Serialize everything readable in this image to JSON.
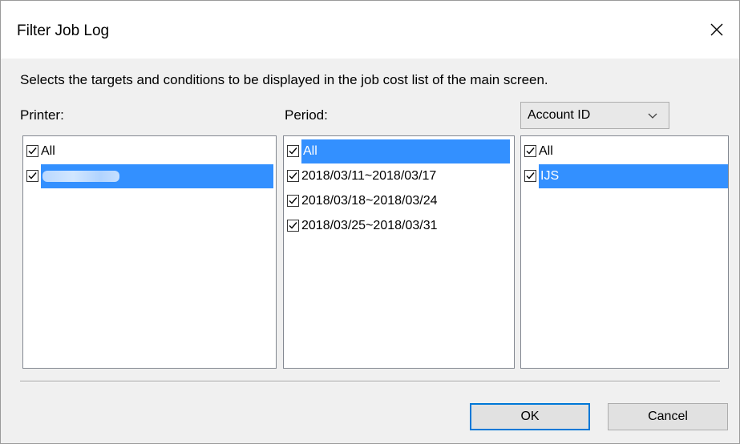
{
  "dialog": {
    "title": "Filter Job Log",
    "description": "Selects the targets and conditions to be displayed in the job cost list of the main screen."
  },
  "printer": {
    "label": "Printer:",
    "items": [
      {
        "label": "All",
        "checked": true
      },
      {
        "label": "",
        "checked": true,
        "selected": true,
        "redacted": true
      }
    ]
  },
  "period": {
    "label": "Period:",
    "items": [
      {
        "label": "All",
        "checked": true,
        "selected": true
      },
      {
        "label": "2018/03/11~2018/03/17",
        "checked": true
      },
      {
        "label": "2018/03/18~2018/03/24",
        "checked": true
      },
      {
        "label": "2018/03/25~2018/03/31",
        "checked": true
      }
    ]
  },
  "account": {
    "dropdown_value": "Account ID",
    "items": [
      {
        "label": "All",
        "checked": true
      },
      {
        "label": "IJS",
        "checked": true,
        "selected": true
      }
    ]
  },
  "buttons": {
    "ok": "OK",
    "cancel": "Cancel"
  },
  "colors": {
    "selection": "#3390ff",
    "default_button_border": "#0078d7"
  }
}
